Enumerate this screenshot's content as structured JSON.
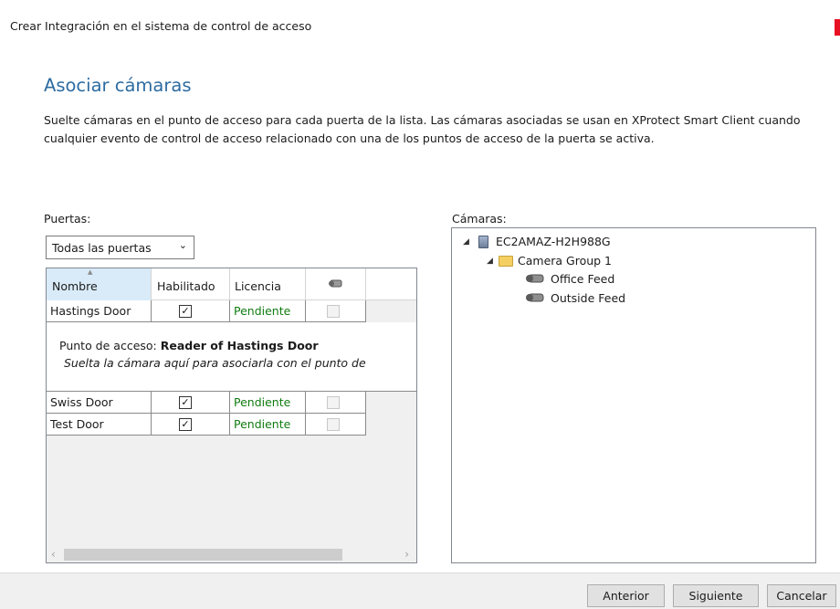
{
  "window": {
    "title": "Crear Integración en el sistema de control de acceso"
  },
  "page": {
    "heading": "Asociar cámaras",
    "description": "Suelte cámaras en el punto de acceso para cada puerta de la lista. Las cámaras asociadas se usan en XProtect Smart Client cuando cualquier evento de control de acceso relacionado con una de los puntos de acceso de la puerta se activa."
  },
  "doors": {
    "label": "Puertas:",
    "filter": {
      "selected": "Todas las puertas"
    },
    "columns": {
      "name": "Nombre",
      "enabled": "Habilitado",
      "license": "Licencia",
      "camera_icon": "camera-icon"
    },
    "rows": [
      {
        "name": "Hastings Door",
        "enabled": "✓",
        "license": "Pendiente"
      },
      {
        "name": "Swiss Door",
        "enabled": "✓",
        "license": "Pendiente"
      },
      {
        "name": "Test Door",
        "enabled": "✓",
        "license": "Pendiente"
      }
    ],
    "detail": {
      "access_point_label": "Punto de acceso:",
      "access_point_name": "Reader of Hastings Door",
      "drop_hint": "Suelta la cámara aquí para asociarla con el punto de"
    }
  },
  "cameras": {
    "label": "Cámaras:",
    "server": "EC2AMAZ-H2H988G",
    "group": "Camera Group 1",
    "items": [
      "Office Feed",
      "Outside Feed"
    ]
  },
  "buttons": {
    "back": "Anterior",
    "next": "Siguiente",
    "cancel": "Cancelar"
  },
  "colors": {
    "heading": "#2d6ca2",
    "status_pending": "#107c10",
    "close": "#e81123"
  }
}
